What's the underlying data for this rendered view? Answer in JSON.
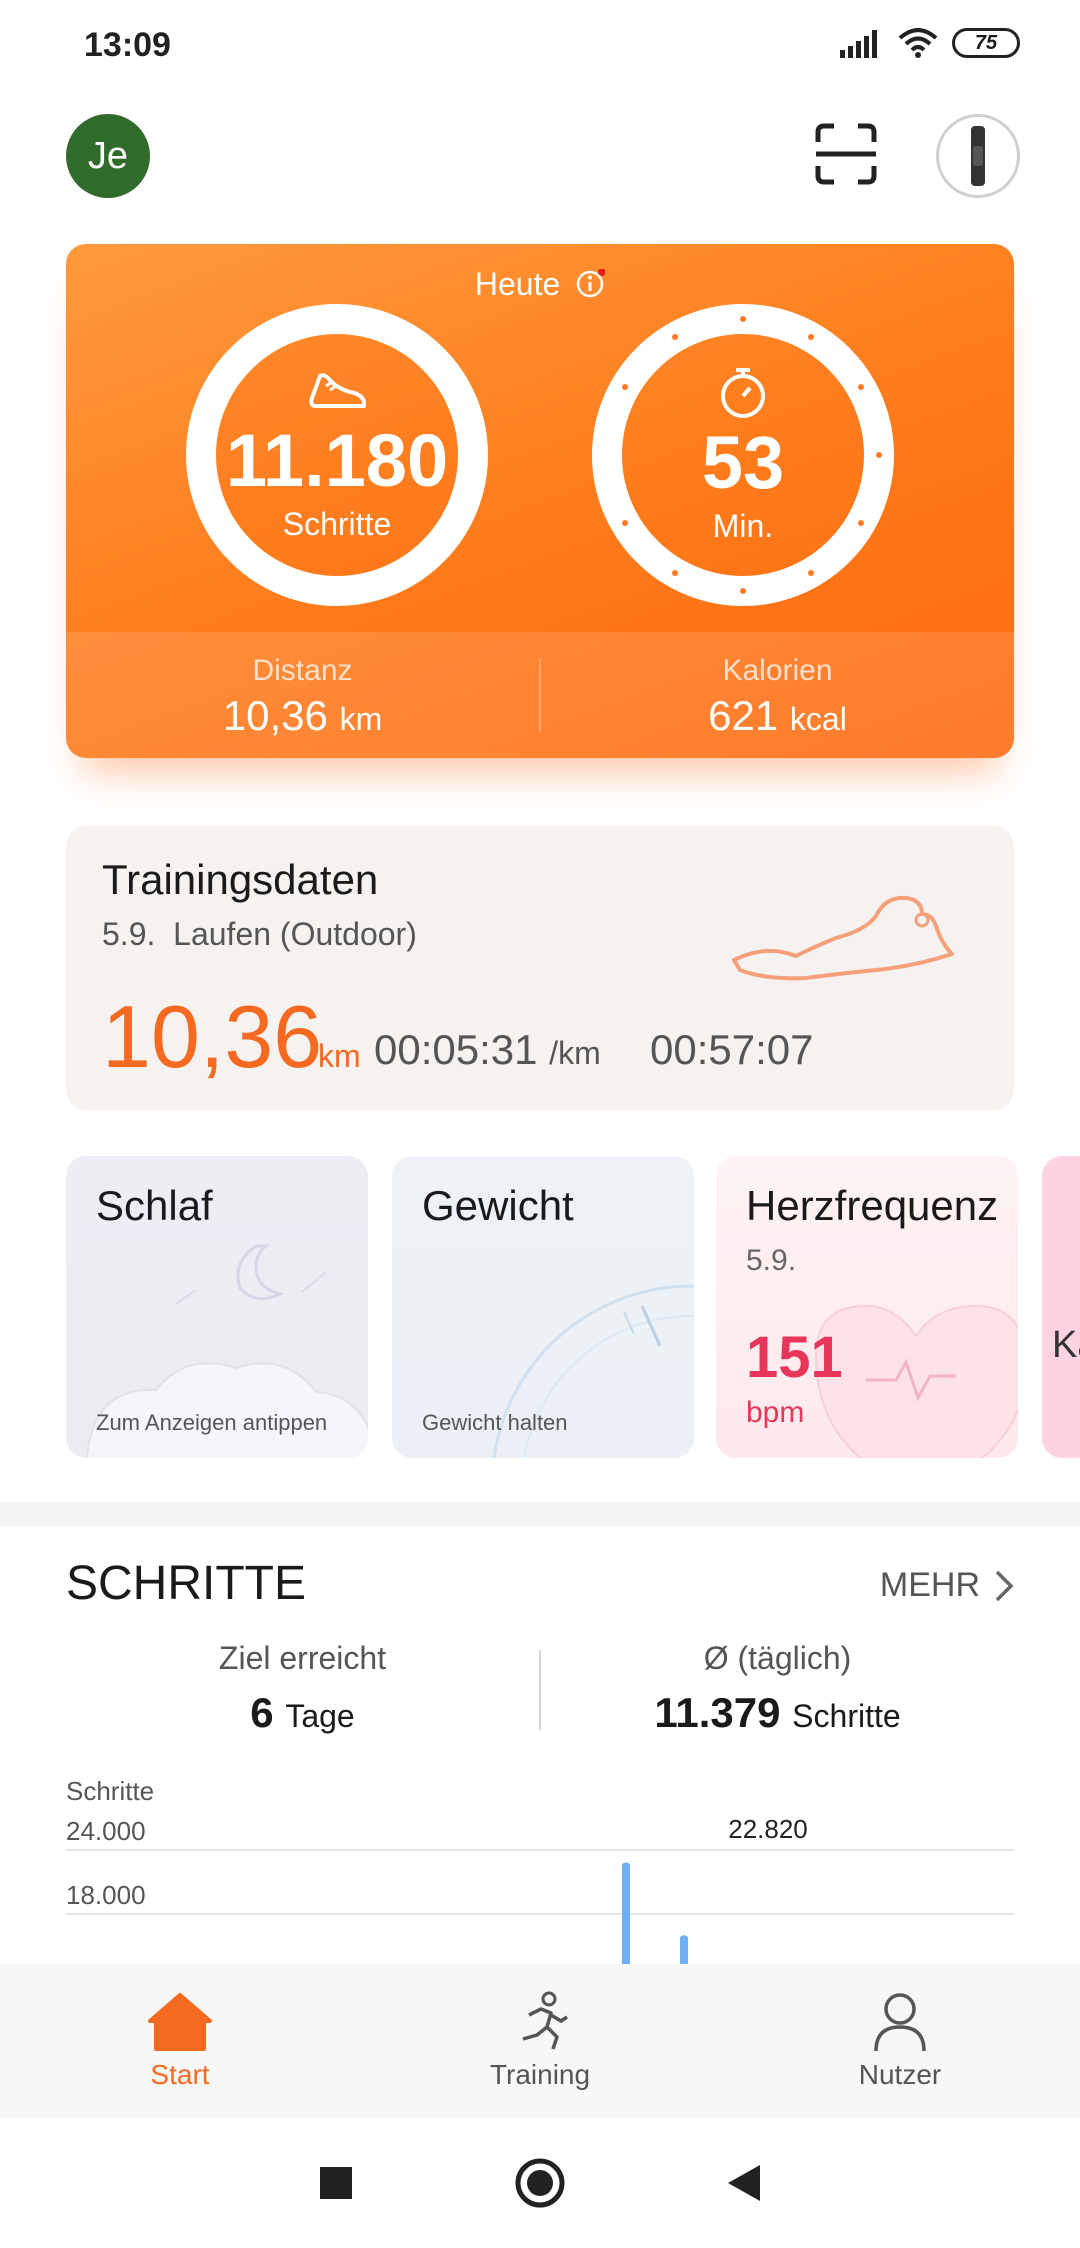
{
  "status": {
    "time": "13:09",
    "battery": "75"
  },
  "header": {
    "avatar_initials": "Je"
  },
  "today": {
    "label": "Heute",
    "steps_value": "11.180",
    "steps_unit": "Schritte",
    "minutes_value": "53",
    "minutes_unit": "Min.",
    "distance_label": "Distanz",
    "distance_value": "10,36",
    "distance_unit": "km",
    "calories_label": "Kalorien",
    "calories_value": "621",
    "calories_unit": "kcal"
  },
  "training": {
    "title": "Trainingsdaten",
    "date": "5.9.",
    "activity": "Laufen (Outdoor)",
    "distance": "10,36",
    "distance_unit": "km",
    "pace": "00:05:31",
    "pace_unit": "/km",
    "duration": "00:57:07"
  },
  "tiles": {
    "sleep": {
      "title": "Schlaf",
      "hint": "Zum Anzeigen antippen"
    },
    "weight": {
      "title": "Gewicht",
      "hint": "Gewicht halten"
    },
    "heart": {
      "title": "Herzfrequenz",
      "date": "5.9.",
      "value": "151",
      "unit": "bpm"
    },
    "extra": {
      "title": "Ka"
    }
  },
  "steps_section": {
    "title": "SCHRITTE",
    "more": "MEHR",
    "goal_label": "Ziel erreicht",
    "goal_value": "6",
    "goal_unit": "Tage",
    "avg_label": "Ø (täglich)",
    "avg_value": "11.379",
    "avg_unit": "Schritte"
  },
  "chart_data": {
    "type": "bar",
    "ylabel": "Schritte",
    "yticks": [
      "24.000",
      "18.000"
    ],
    "highlight_label": "22.820",
    "values": [
      null,
      null,
      null,
      null,
      null,
      null,
      null,
      13000,
      22820,
      16000
    ],
    "ylim": [
      12000,
      24000
    ]
  },
  "nav": {
    "start": "Start",
    "training": "Training",
    "user": "Nutzer"
  },
  "colors": {
    "accent": "#f56a20",
    "heart": "#e8365a",
    "bar": "#6fb0f5"
  }
}
